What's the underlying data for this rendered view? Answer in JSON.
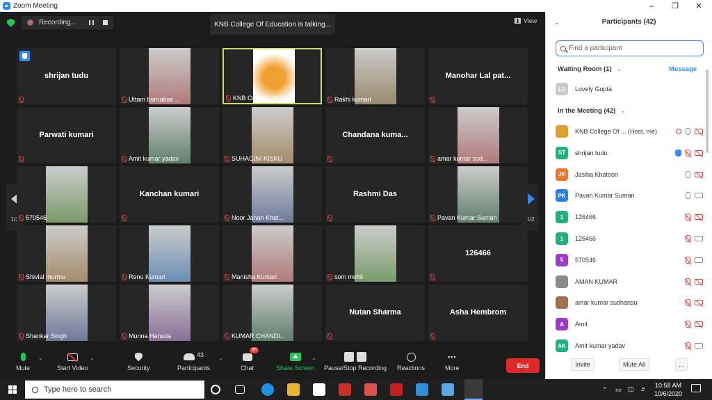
{
  "window": {
    "title": "Zoom Meeting"
  },
  "meeting_bar": {
    "recording_label": "Recording...",
    "talking_banner": "KNB College Of Education is talking...",
    "view_label": "View"
  },
  "pager": {
    "left": "1/2",
    "right": "1/2"
  },
  "tiles": [
    {
      "label": "shrijan tudu",
      "video": false,
      "hand": true
    },
    {
      "label": "Uttam barnabas ...",
      "video": true
    },
    {
      "label": "KNB College Of Edu...",
      "video": true,
      "active": true
    },
    {
      "label": "Rakhi kumari",
      "video": true
    },
    {
      "label": "Manohar Lal pat...",
      "video": false
    },
    {
      "label": "Parwati kumari",
      "video": false
    },
    {
      "label": "Amit kumar yadav",
      "video": true
    },
    {
      "label": "SUHAGINI KISKU",
      "video": true
    },
    {
      "label": "Chandana kuma...",
      "video": false
    },
    {
      "label": "amar kumar sud...",
      "video": true
    },
    {
      "label": "570546",
      "video": true
    },
    {
      "label": "Kanchan kumari",
      "video": false
    },
    {
      "label": "Noor Jahan Khat...",
      "video": true
    },
    {
      "label": "Rashmi Das",
      "video": false
    },
    {
      "label": "Pavan Kumar Suman",
      "video": true
    },
    {
      "label": "Shivlal murmu",
      "video": true
    },
    {
      "label": "Renu Kumari",
      "video": true
    },
    {
      "label": "Manisha Kumari",
      "video": true
    },
    {
      "label": "som mohli",
      "video": true
    },
    {
      "label": "126466",
      "video": false
    },
    {
      "label": "Shankar Singh",
      "video": true
    },
    {
      "label": "Munna Hansda",
      "video": true
    },
    {
      "label": "KUMAR CHANDI...",
      "video": true
    },
    {
      "label": "Nutan Sharma",
      "video": false
    },
    {
      "label": "Asha Hembrom",
      "video": false
    }
  ],
  "toolbar": {
    "mute": "Mute",
    "start_video": "Start Video",
    "security": "Security",
    "participants": "Participants",
    "participants_count": "43",
    "chat": "Chat",
    "chat_badge": "35",
    "share_screen": "Share Screen",
    "pause_stop": "Pause/Stop Recording",
    "reactions": "Reactions",
    "more": "More",
    "end": "End"
  },
  "sidebar": {
    "title": "Participants (42)",
    "search_placeholder": "Find a participant",
    "waiting_room": "Waiting Room (1)",
    "message": "Message",
    "waiting": [
      {
        "initials": "LG",
        "name": "Lovely Gupta",
        "color": "#c9c9c9"
      }
    ],
    "in_meeting": "In the Meeting (42)",
    "participants": [
      {
        "initials": "",
        "name": "KNB College Of ...",
        "suffix": "(Host, me)",
        "color": "#e0a030",
        "mic": "on",
        "cam": "off",
        "rec": true
      },
      {
        "initials": "ST",
        "name": "shrijan tudu",
        "color": "#22b07d",
        "mic": "off",
        "cam": "off",
        "hand": true
      },
      {
        "initials": "JK",
        "name": "Jasiba Khatoon",
        "color": "#e8762c",
        "mic": "on",
        "cam": "off"
      },
      {
        "initials": "PK",
        "name": "Pavan Kumar Suman",
        "color": "#2d7ee0",
        "mic": "on",
        "cam": "on"
      },
      {
        "initials": "1",
        "name": "126466",
        "color": "#22b07d",
        "mic": "off",
        "cam": "off"
      },
      {
        "initials": "1",
        "name": "126466",
        "color": "#22b07d",
        "mic": "off",
        "cam": "on"
      },
      {
        "initials": "5",
        "name": "570546",
        "color": "#9b3cc8",
        "mic": "off",
        "cam": "on"
      },
      {
        "initials": "",
        "name": "AMAN KUMAR",
        "color": "#8a8a8a",
        "mic": "off",
        "cam": "off"
      },
      {
        "initials": "",
        "name": "amar kumar sudhansu",
        "color": "#a07050",
        "mic": "off",
        "cam": "off"
      },
      {
        "initials": "A",
        "name": "Amit",
        "color": "#9b3cc8",
        "mic": "off",
        "cam": "off"
      },
      {
        "initials": "AK",
        "name": "Amit kumar yadav",
        "color": "#22b07d",
        "mic": "off",
        "cam": "on"
      }
    ],
    "invite": "Invite",
    "mute_all": "Mute All",
    "more": "..."
  },
  "taskbar": {
    "search_placeholder": "Type here to search",
    "time": "10:58 AM",
    "date": "10/6/2020"
  }
}
